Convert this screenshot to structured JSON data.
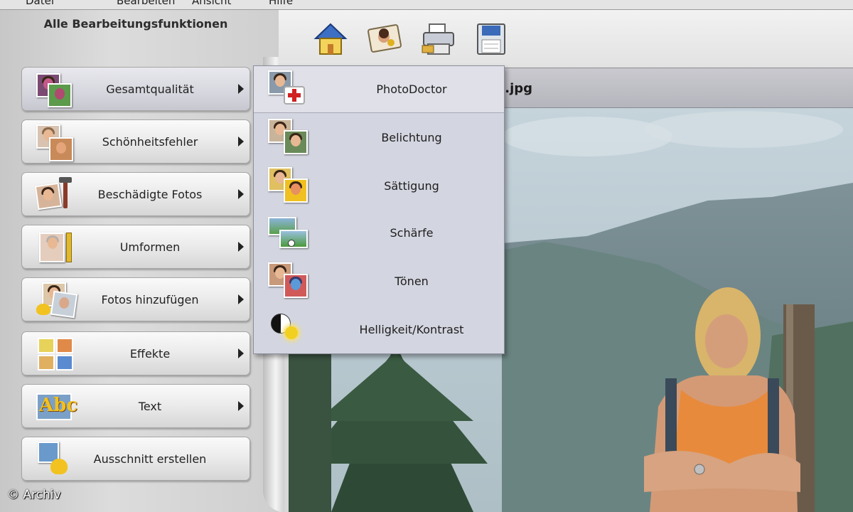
{
  "menubar": {
    "items": [
      "Datei",
      "Bearbeiten",
      "Ansicht",
      "Hilfe"
    ]
  },
  "sidebar": {
    "title": "Alle Bearbeitungsfunktionen",
    "items": [
      {
        "label": "Gesamtqualität",
        "icon": "quality-photos-icon",
        "has_submenu": true,
        "active": true
      },
      {
        "label": "Schönheitsfehler",
        "icon": "blemish-photos-icon",
        "has_submenu": true
      },
      {
        "label": "Beschädigte Fotos",
        "icon": "damaged-photo-icon",
        "has_submenu": true
      },
      {
        "label": "Umformen",
        "icon": "transform-photo-icon",
        "has_submenu": true
      },
      {
        "label": "Fotos hinzufügen",
        "icon": "add-photos-icon",
        "has_submenu": true
      },
      {
        "label": "Effekte",
        "icon": "effects-icon",
        "has_submenu": true
      },
      {
        "label": "Text",
        "icon": "text-abc-icon",
        "has_submenu": true
      },
      {
        "label": "Ausschnitt erstellen",
        "icon": "crop-icon",
        "has_submenu": false
      }
    ]
  },
  "toolbar": {
    "buttons": [
      {
        "name": "home-icon"
      },
      {
        "name": "photo-share-icon"
      },
      {
        "name": "printer-icon"
      },
      {
        "name": "save-disk-icon"
      }
    ]
  },
  "file": {
    "name_fragment": ").jpg"
  },
  "submenu": {
    "items": [
      {
        "label": "PhotoDoctor",
        "icon": "photo-doctor-icon"
      },
      {
        "label": "Belichtung",
        "icon": "exposure-icon"
      },
      {
        "label": "Sättigung",
        "icon": "saturation-icon"
      },
      {
        "label": "Schärfe",
        "icon": "sharpness-icon"
      },
      {
        "label": "Tönen",
        "icon": "tint-icon"
      },
      {
        "label": "Helligkeit/Kontrast",
        "icon": "brightness-contrast-icon"
      }
    ]
  },
  "copyright": "© Archiv",
  "colors": {
    "submenu_bg": "#d3d5e0",
    "panel_bg": "#d4d4d4",
    "sky": "#c8d4db"
  }
}
